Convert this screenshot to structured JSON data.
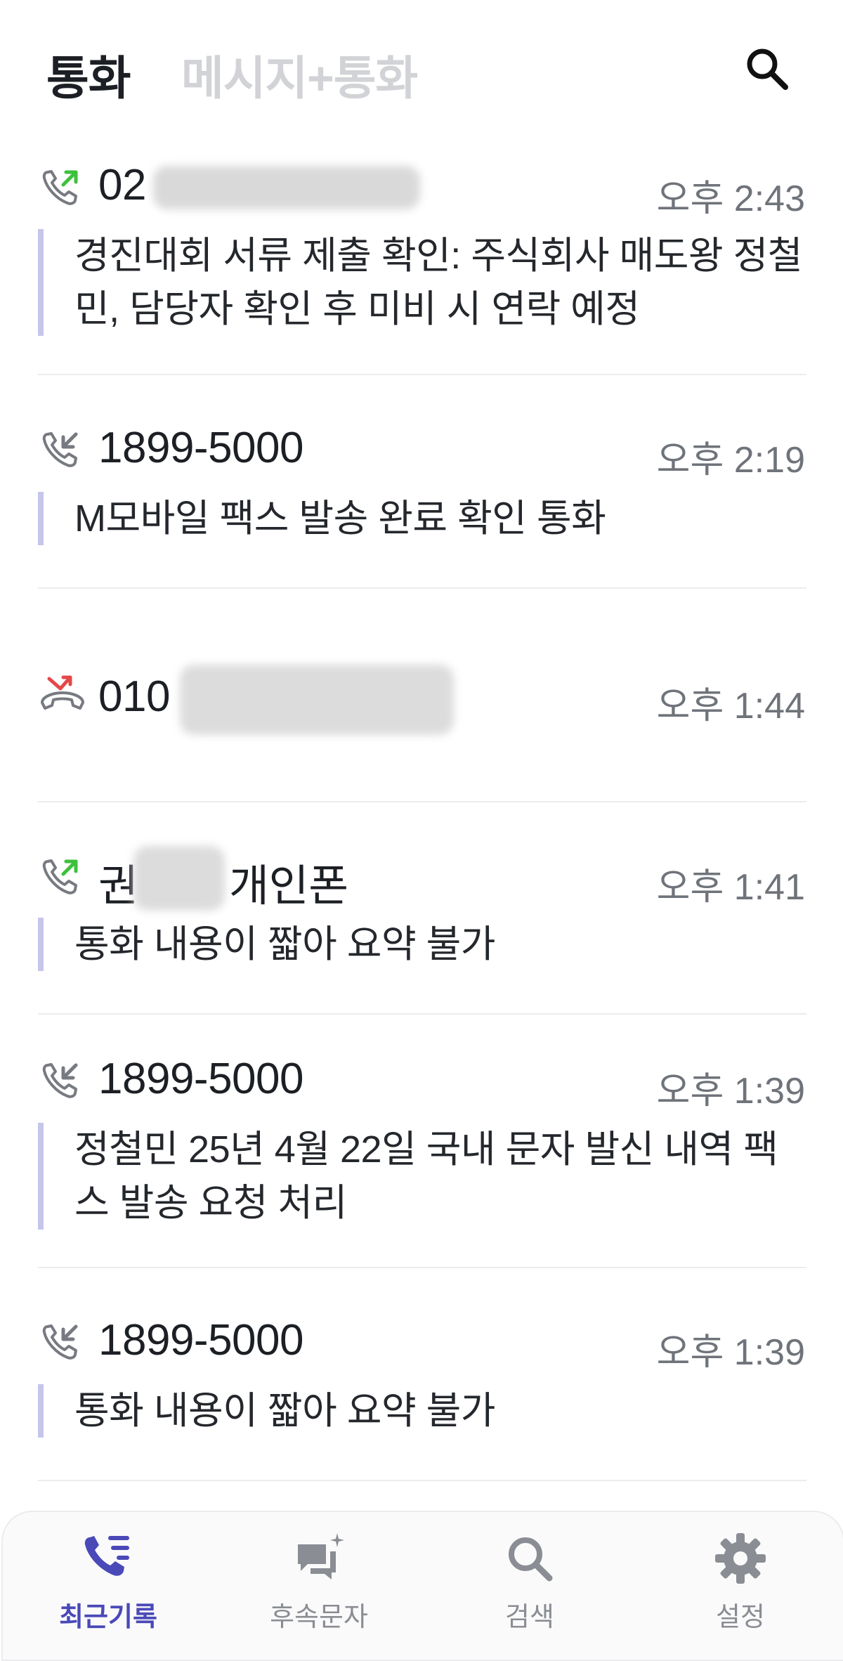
{
  "header": {
    "tab_calls": "통화",
    "tab_messages_calls": "메시지+통화",
    "search_icon": "search-icon"
  },
  "calls": [
    {
      "direction": "outgoing",
      "direction_icon": "outgoing-call-icon",
      "caller": "02",
      "caller_redacted": true,
      "time": "오후 2:43",
      "summary": "경진대회 서류 제출 확인: 주식회사 매도왕 정철민, 담당자 확인 후 미비 시 연락 예정"
    },
    {
      "direction": "incoming",
      "direction_icon": "incoming-call-icon",
      "caller": "1899-5000",
      "time": "오후 2:19",
      "summary": "M모바일 팩스 발송 완료 확인 통화"
    },
    {
      "direction": "missed",
      "direction_icon": "missed-call-icon",
      "caller": "010",
      "caller_redacted": true,
      "time": "오후 1:44",
      "summary": ""
    },
    {
      "direction": "outgoing",
      "direction_icon": "outgoing-call-icon",
      "caller_prefix": "권",
      "caller_suffix": "개인폰",
      "caller_redacted": true,
      "time": "오후 1:41",
      "summary": "통화 내용이 짧아 요약 불가"
    },
    {
      "direction": "incoming",
      "direction_icon": "incoming-call-icon",
      "caller": "1899-5000",
      "time": "오후 1:39",
      "summary": "정철민 25년 4월 22일 국내 문자 발신 내역 팩스 발송 요청 처리"
    },
    {
      "direction": "incoming",
      "direction_icon": "incoming-call-icon",
      "caller": "1899-5000",
      "time": "오후 1:39",
      "summary": "통화 내용이 짧아 요약 불가"
    }
  ],
  "nav": {
    "items": [
      {
        "label": "최근기록",
        "icon": "recent-calls-icon",
        "active": true
      },
      {
        "label": "후속문자",
        "icon": "follow-up-message-icon",
        "active": false
      },
      {
        "label": "검색",
        "icon": "search-icon",
        "active": false
      },
      {
        "label": "설정",
        "icon": "settings-icon",
        "active": false
      }
    ]
  },
  "colors": {
    "accent": "#4a49b8",
    "summary_bar": "#c6c6ec",
    "outgoing_arrow": "#3cc13b",
    "missed_arrow": "#e54848",
    "inactive_tab": "#d2d3d6"
  }
}
